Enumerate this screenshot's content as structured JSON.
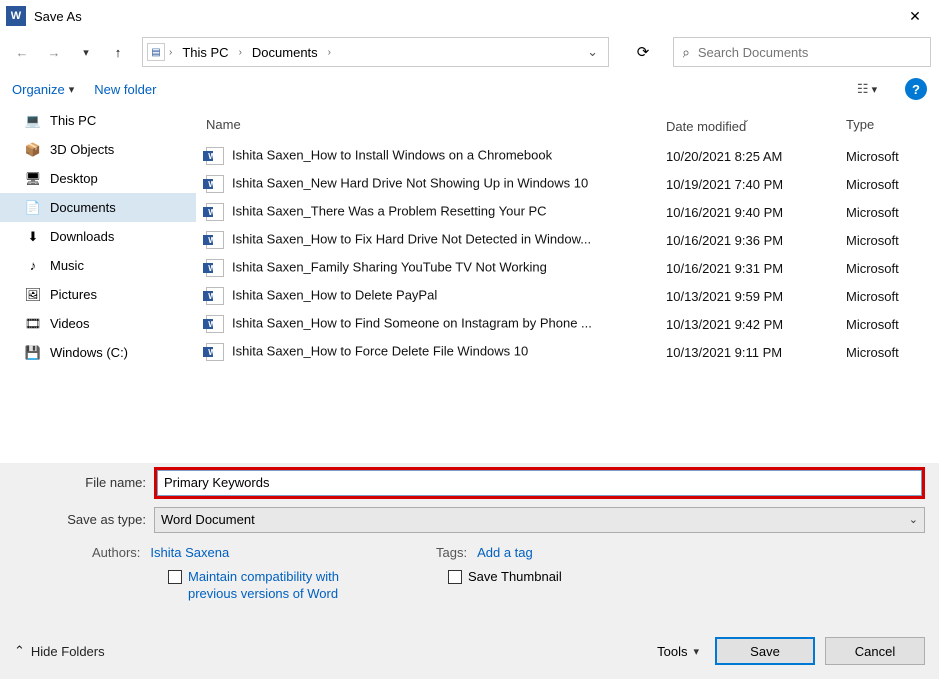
{
  "window": {
    "title": "Save As"
  },
  "breadcrumb": {
    "seg1": "This PC",
    "seg2": "Documents"
  },
  "search": {
    "placeholder": "Search Documents"
  },
  "toolbar": {
    "organize": "Organize",
    "newfolder": "New folder"
  },
  "sidebar": {
    "items": [
      {
        "label": "This PC",
        "icon": "💻"
      },
      {
        "label": "3D Objects",
        "icon": "📦"
      },
      {
        "label": "Desktop",
        "icon": "🖥"
      },
      {
        "label": "Documents",
        "icon": "📄",
        "selected": true
      },
      {
        "label": "Downloads",
        "icon": "⬇"
      },
      {
        "label": "Music",
        "icon": "♪"
      },
      {
        "label": "Pictures",
        "icon": "🖼"
      },
      {
        "label": "Videos",
        "icon": "🎞"
      },
      {
        "label": "Windows (C:)",
        "icon": "💾"
      }
    ]
  },
  "columns": {
    "name": "Name",
    "date": "Date modified",
    "type": "Type"
  },
  "files": [
    {
      "name": "Ishita Saxen_How to Install Windows on a Chromebook",
      "date": "10/20/2021 8:25 AM",
      "type": "Microsoft"
    },
    {
      "name": "Ishita Saxen_New Hard Drive Not Showing Up in Windows 10",
      "date": "10/19/2021 7:40 PM",
      "type": "Microsoft"
    },
    {
      "name": "Ishita Saxen_There Was a Problem Resetting Your PC",
      "date": "10/16/2021 9:40 PM",
      "type": "Microsoft"
    },
    {
      "name": "Ishita Saxen_How to Fix Hard Drive Not Detected in Window...",
      "date": "10/16/2021 9:36 PM",
      "type": "Microsoft"
    },
    {
      "name": "Ishita Saxen_Family Sharing YouTube TV Not Working",
      "date": "10/16/2021 9:31 PM",
      "type": "Microsoft"
    },
    {
      "name": "Ishita Saxen_How to Delete PayPal",
      "date": "10/13/2021 9:59 PM",
      "type": "Microsoft"
    },
    {
      "name": "Ishita Saxen_How to Find Someone on Instagram by Phone ...",
      "date": "10/13/2021 9:42 PM",
      "type": "Microsoft"
    },
    {
      "name": "Ishita Saxen_How to Force Delete File Windows 10",
      "date": "10/13/2021 9:11 PM",
      "type": "Microsoft"
    }
  ],
  "form": {
    "filename_label": "File name:",
    "filename_value": "Primary Keywords",
    "savetype_label": "Save as type:",
    "savetype_value": "Word Document",
    "authors_label": "Authors:",
    "authors_value": "Ishita Saxena",
    "tags_label": "Tags:",
    "tags_value": "Add a tag",
    "compat_label": "Maintain compatibility with previous versions of Word",
    "thumb_label": "Save Thumbnail"
  },
  "footer": {
    "hide": "Hide Folders",
    "tools": "Tools",
    "save": "Save",
    "cancel": "Cancel"
  }
}
